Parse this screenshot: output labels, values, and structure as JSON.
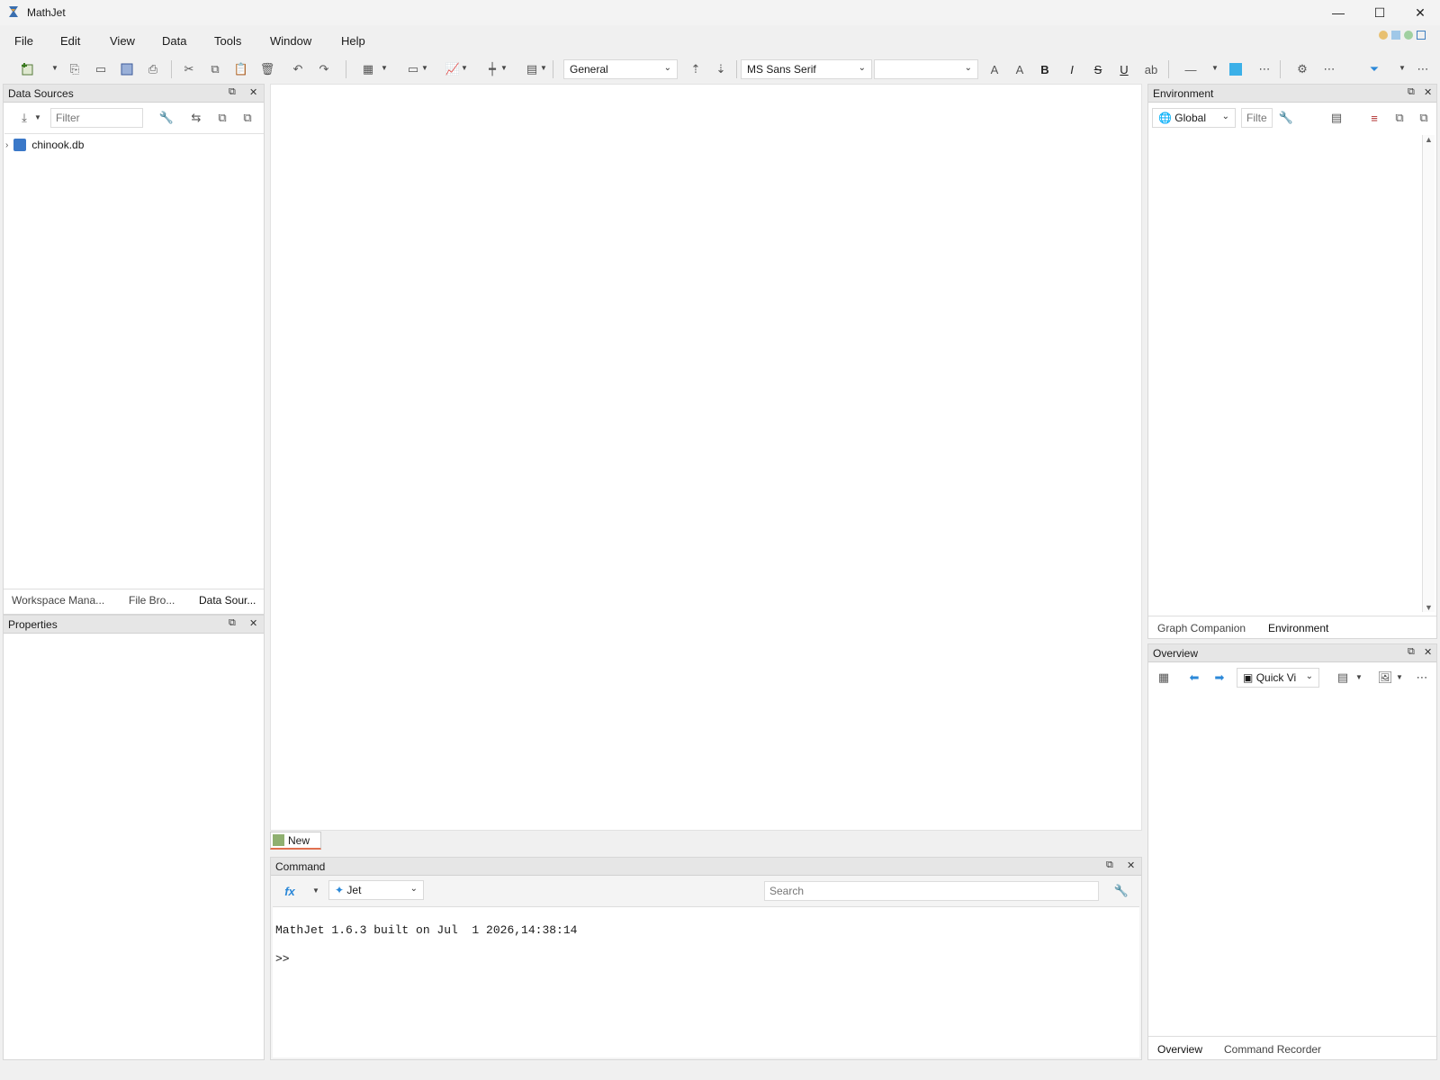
{
  "window": {
    "title": "MathJet",
    "minimize": "—",
    "maximize": "☐",
    "close": "✕"
  },
  "menu": [
    "File",
    "Edit",
    "View",
    "Data",
    "Tools",
    "Window",
    "Help"
  ],
  "toolbar": {
    "format_combo": "General",
    "font_combo": "MS Sans Serif",
    "size_combo": "",
    "bold": "B",
    "italic": "I",
    "strike": "S",
    "underline": "U"
  },
  "data_sources": {
    "title": "Data Sources",
    "filter_placeholder": "Filter",
    "tree_item": "chinook.db",
    "tabs": [
      "Workspace Mana...",
      "File Bro...",
      "Data Sour..."
    ]
  },
  "properties": {
    "title": "Properties"
  },
  "document_tab": {
    "label": "New"
  },
  "command": {
    "title": "Command",
    "engine": "Jet",
    "search_placeholder": "Search",
    "banner": "MathJet 1.6.3 built on Jul  1 2026,14:38:14",
    "prompt": ">>"
  },
  "environment": {
    "title": "Environment",
    "scope": "Global",
    "filter_placeholder": "Filter",
    "tabs": [
      "Graph Companion",
      "Environment"
    ]
  },
  "overview": {
    "title": "Overview",
    "view_combo": "Quick Vi",
    "tabs": [
      "Overview",
      "Command Recorder"
    ]
  },
  "colors": {
    "accent": "#2b88d8",
    "tab_underline": "#e07050",
    "header_bg": "#e6e6e6"
  }
}
